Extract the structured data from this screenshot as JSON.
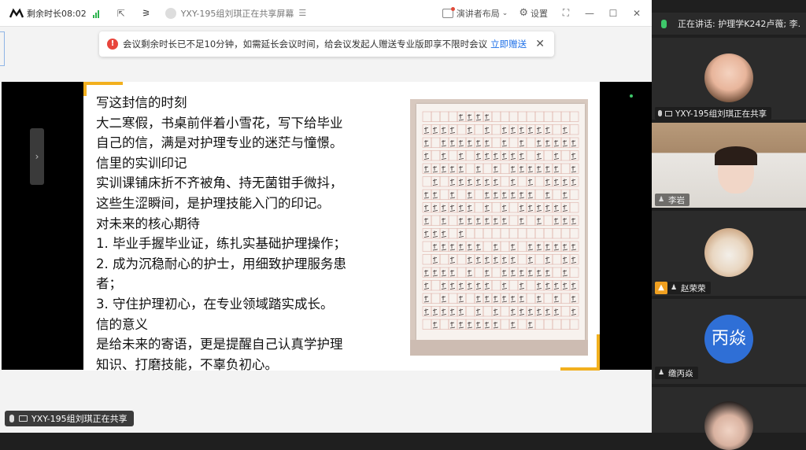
{
  "topbar": {
    "remaining_time": "剩余时长08:02",
    "share_title": "YXY-195组刘琪正在共享屏幕",
    "layout_label": "演讲者布局",
    "settings_label": "设置"
  },
  "notice": {
    "message": "会议剩余时长已不足10分钟，如需延长会议时间，给会议发起人赠送专业版即享不限时会议",
    "link": "立即赠送"
  },
  "slide": {
    "lines": [
      "写这封信的时刻",
      "大二寒假，书桌前伴着小雪花，写下给毕业",
      "自己的信，满是对护理专业的迷茫与憧憬。",
      "信里的实训印记",
      "实训课铺床折不齐被角、持无菌钳手微抖，",
      "这些生涩瞬间，是护理技能入门的印记。",
      "对未来的核心期待",
      "1. 毕业手握毕业证，练扎实基础护理操作；",
      "2. 成为沉稳耐心的护士，用细致护理服务患",
      "者；",
      "3. 守住护理初心，在专业领域踏实成长。",
      "信的意义",
      "是给未来的寄语，更是提醒自己认真学护理",
      "知识、打磨技能，不辜负初心。"
    ]
  },
  "bottom": {
    "sharing_label": "YXY-195组刘琪正在共享"
  },
  "side": {
    "speaking": "正在讲话:  护理学K242卢薇; 李.",
    "participants": [
      {
        "name": "YXY-195组刘琪正在共享"
      },
      {
        "name": "李岩"
      },
      {
        "name": "赵荣荣"
      },
      {
        "name": "缴丙焱",
        "initials": "丙焱"
      }
    ]
  },
  "colors": {
    "accent": "#f2b01e",
    "link": "#1c6fe8",
    "warn": "#e8453c",
    "avatar_blue": "#2f6fd6"
  }
}
